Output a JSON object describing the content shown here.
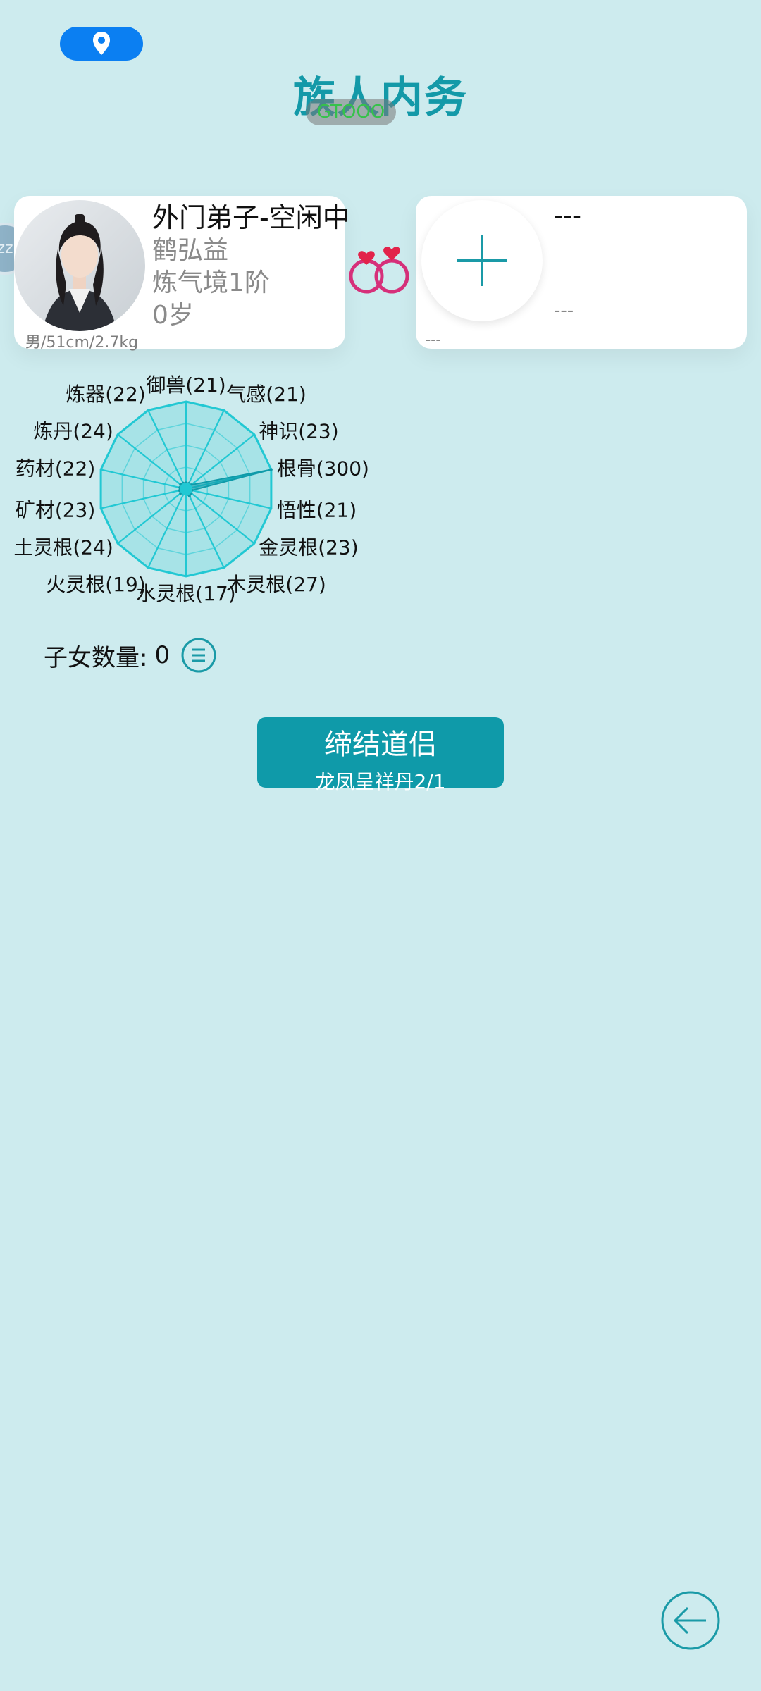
{
  "header": {
    "title": "族人内务",
    "pill_text": "GTOOO",
    "location_icon": "location-pin-icon",
    "accent": "#1399a8"
  },
  "left_card": {
    "status": "外门弟子-空闲中",
    "name": "鹤弘益",
    "realm": "炼气境1阶",
    "age": "0岁",
    "stats": "男/51cm/2.7kg",
    "side_chip": "zz"
  },
  "right_card": {
    "title": "---",
    "subtitle": "---",
    "footer": "---",
    "add_icon": "plus-icon"
  },
  "rings_icon": "wedding-rings-icon",
  "chart_data": {
    "type": "radar",
    "labels": [
      "御兽(21)",
      "气感(21)",
      "神识(23)",
      "根骨(300)",
      "悟性(21)",
      "金灵根(23)",
      "木灵根(27)",
      "水灵根(17)",
      "火灵根(19)",
      "土灵根(24)",
      "矿材(23)",
      "药材(22)",
      "炼丹(24)",
      "炼器(22)"
    ],
    "values": [
      21,
      21,
      23,
      300,
      21,
      23,
      27,
      17,
      19,
      24,
      23,
      22,
      24,
      22
    ],
    "rmax": 300,
    "grid_levels": 4,
    "color": "#22c8d3"
  },
  "children": {
    "label": "子女数量:",
    "count": "0",
    "list_icon": "list-icon"
  },
  "marry_button": {
    "label": "缔结道侣",
    "sub_label": "龙凤呈祥丹2/1",
    "color": "#0f9aa9"
  },
  "back_icon": "back-arrow-icon"
}
